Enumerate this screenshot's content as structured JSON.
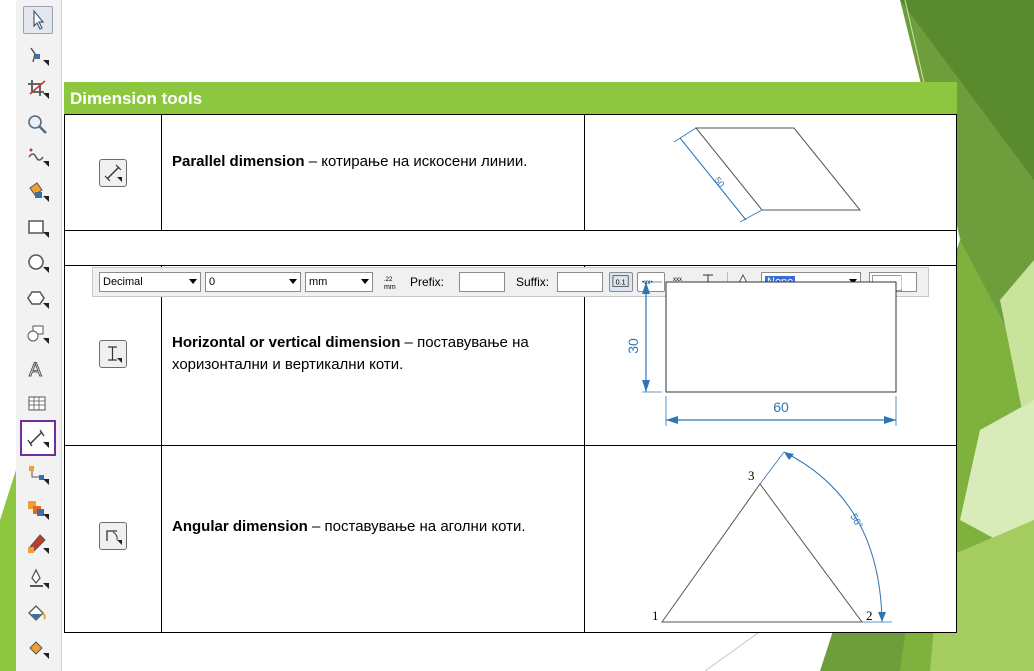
{
  "header": {
    "title": "Dimension tools"
  },
  "rows": [
    {
      "term": "Parallel dimension",
      "sep": " – ",
      "desc": "котирање на искосени линии."
    },
    {
      "term": "Horizontal or vertical dimension",
      "sep": " – ",
      "desc": "поставување на хоризонтални и вертикални коти."
    },
    {
      "term": "Angular dimension",
      "sep": " – ",
      "desc": "поставување на аголни коти."
    }
  ],
  "propbar": {
    "style": "Decimal",
    "precision": "0",
    "units": "mm",
    "prefix_label": "Prefix:",
    "prefix_value": "",
    "suffix_label": "Suffix:",
    "suffix_value": "",
    "outline": "None"
  },
  "figures": {
    "parallel_label": "50",
    "vertical_label": "30",
    "horizontal_label": "60",
    "angle_label": "56°",
    "vertex_1": "1",
    "vertex_2": "2",
    "vertex_3": "3"
  },
  "colors": {
    "header": "#8dc63f",
    "dimension": "#2e75b6",
    "active_tool": "#7030a0"
  },
  "toolbox_icons": [
    "pick-tool-icon",
    "shape-tool-icon",
    "crop-tool-icon",
    "zoom-tool-icon",
    "freehand-tool-icon",
    "smart-fill-tool-icon",
    "rectangle-tool-icon",
    "ellipse-tool-icon",
    "polygon-tool-icon",
    "basic-shapes-tool-icon",
    "text-tool-icon",
    "table-tool-icon",
    "dimension-tool-icon",
    "connector-tool-icon",
    "blend-tool-icon",
    "eyedropper-tool-icon",
    "outline-tool-icon",
    "fill-tool-icon",
    "interactive-fill-tool-icon"
  ]
}
